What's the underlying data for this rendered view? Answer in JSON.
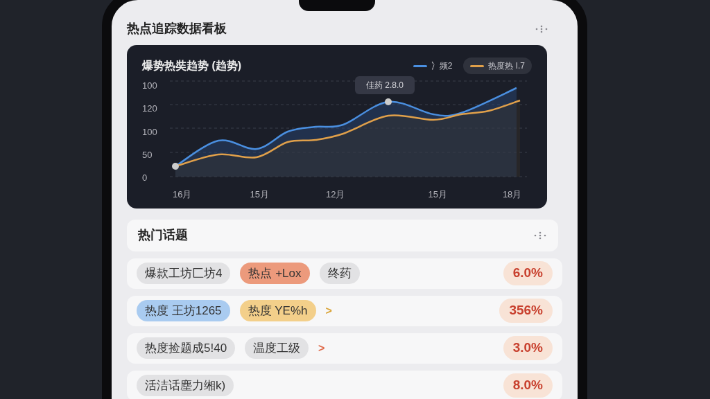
{
  "header": {
    "title": "热点追踪数据看板"
  },
  "chart_card": {
    "title": "爆势热奘趋势 (趋势)",
    "legend": [
      {
        "label": "冫频2",
        "color": "#4a8fe0",
        "selected": false
      },
      {
        "label": "热度热 I.7",
        "color": "#e0a04a",
        "selected": true
      }
    ],
    "tooltip": "佳药 2.8.0",
    "y_axis_labels": [
      "100",
      "120",
      "100",
      "50",
      "0"
    ],
    "x_axis_labels": [
      "16月",
      "15月",
      "12月",
      "15月",
      "18月"
    ]
  },
  "topics": {
    "title": "热门话题",
    "rows": [
      {
        "tags": [
          {
            "label": "爆款工坊匚坊4",
            "color": "#e2e2e4"
          },
          {
            "label": "热点 +Lox",
            "color": "#ec9a7c"
          },
          {
            "label": "终药",
            "color": "#e2e2e4"
          }
        ],
        "arrow": null,
        "percent": "6.0%"
      },
      {
        "tags": [
          {
            "label": "热度 王坊1265",
            "color": "#a9cbf0"
          },
          {
            "label": "热度 YE%h",
            "color": "#f3cf8a"
          }
        ],
        "arrow": {
          "text": ">",
          "color": "#d9a233"
        },
        "percent": "356%"
      },
      {
        "tags": [
          {
            "label": "热度捡题成5!40",
            "color": "#e2e2e4"
          },
          {
            "label": "温度工级",
            "color": "#e2e2e4"
          }
        ],
        "arrow": {
          "text": ">",
          "color": "#e06a4a"
        },
        "percent": "3.0%"
      },
      {
        "tags": [
          {
            "label": "活洁话塵力缃k)",
            "color": "#e2e2e4"
          }
        ],
        "arrow": null,
        "percent": "8.0%"
      }
    ]
  }
}
